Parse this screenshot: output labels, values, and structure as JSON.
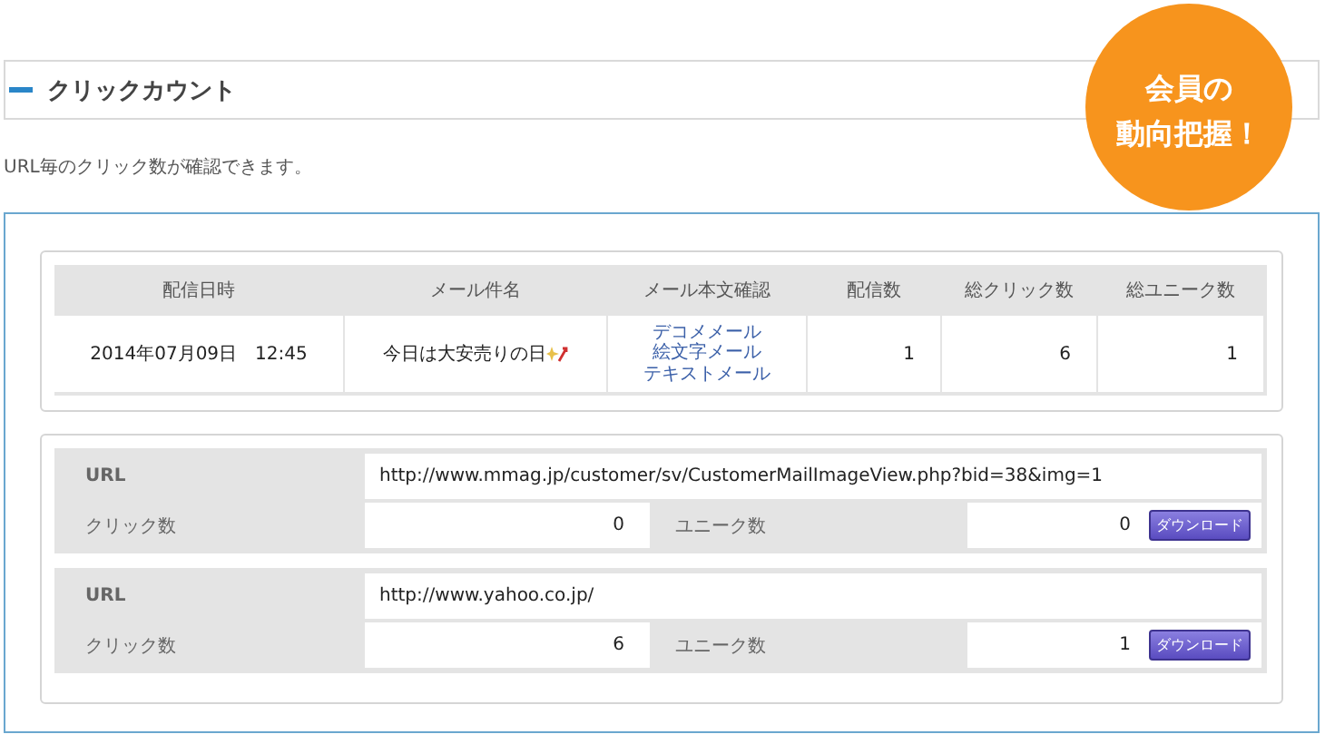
{
  "section": {
    "title": "クリックカウント"
  },
  "description": "URL毎のクリック数が確認できます。",
  "mail_table": {
    "columns": [
      "配信日時",
      "メール件名",
      "メール本文確認",
      "配信数",
      "総クリック数",
      "総ユニーク数"
    ],
    "rows": [
      {
        "date": "2014年07月09日　12:45",
        "subject": "今日は大安売りの日",
        "body_links": [
          "デコメメール",
          "絵文字メール",
          "テキストメール"
        ],
        "sent": "1",
        "clicks": "6",
        "uniques": "1"
      }
    ]
  },
  "url_stats": [
    {
      "url_label": "URL",
      "url": "http://www.mmag.jp/customer/sv/CustomerMailImageView.php?bid=38&img=1",
      "clicks_label": "クリック数",
      "clicks": "0",
      "uniques_label": "ユニーク数",
      "uniques": "0",
      "button": "ダウンロード"
    },
    {
      "url_label": "URL",
      "url": "http://www.yahoo.co.jp/",
      "clicks_label": "クリック数",
      "clicks": "6",
      "uniques_label": "ユニーク数",
      "uniques": "1",
      "button": "ダウンロード"
    }
  ],
  "badge": {
    "lines": [
      "会員の",
      "動向把握！"
    ]
  }
}
